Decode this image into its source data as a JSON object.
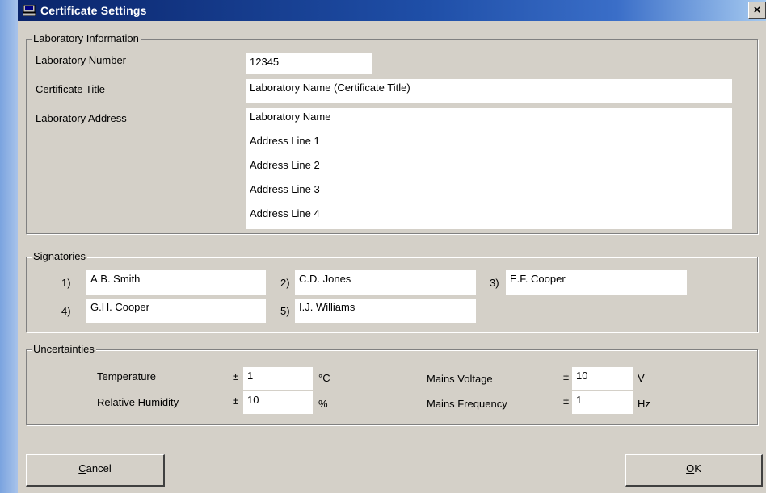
{
  "window": {
    "title": "Certificate Settings",
    "close_glyph": "×"
  },
  "lab": {
    "legend": "Laboratory Information",
    "number_label": "Laboratory Number",
    "number_value": "12345",
    "title_label": "Certificate Title",
    "title_value": "Laboratory Name (Certificate Title)",
    "address_label": "Laboratory Address",
    "address_lines": [
      "Laboratory Name",
      "Address Line 1",
      "Address Line 2",
      "Address Line 3",
      "Address Line 4"
    ]
  },
  "signatories": {
    "legend": "Signatories",
    "items": [
      {
        "num": "1)",
        "name": "A.B. Smith"
      },
      {
        "num": "2)",
        "name": "C.D. Jones"
      },
      {
        "num": "3)",
        "name": "E.F. Cooper"
      },
      {
        "num": "4)",
        "name": "G.H. Cooper"
      },
      {
        "num": "5)",
        "name": "I.J. Williams"
      }
    ]
  },
  "uncertainties": {
    "legend": "Uncertainties",
    "items": [
      {
        "label": "Temperature",
        "pm": "±",
        "value": "1",
        "unit": "°C"
      },
      {
        "label": "Relative Humidity",
        "pm": "±",
        "value": "10",
        "unit": "%"
      },
      {
        "label": "Mains Voltage",
        "pm": "±",
        "value": "10",
        "unit": "V"
      },
      {
        "label": "Mains Frequency",
        "pm": "±",
        "value": "1",
        "unit": "Hz"
      }
    ]
  },
  "buttons": {
    "cancel_first": "C",
    "cancel_rest": "ancel",
    "ok_first": "O",
    "ok_rest": "K"
  },
  "icons": {
    "title_icon": "computer-icon",
    "close": "close-icon"
  }
}
